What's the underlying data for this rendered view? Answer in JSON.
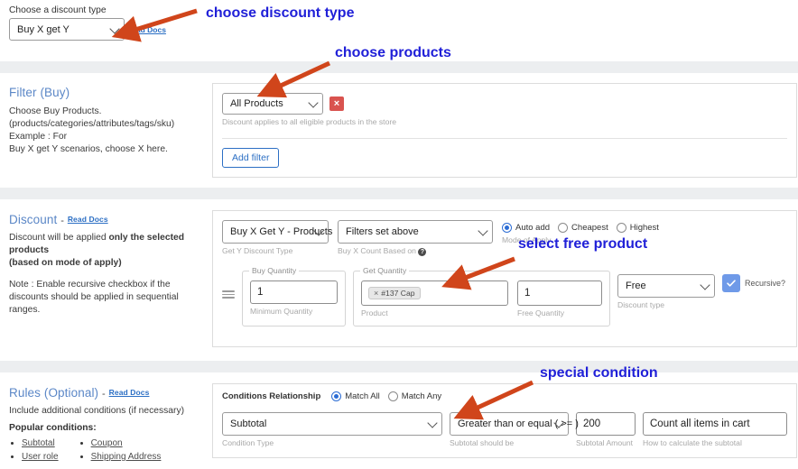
{
  "top": {
    "label": "Choose a discount type",
    "discount_type_value": "Buy X get Y",
    "read_docs": "Read Docs"
  },
  "filter_section": {
    "title": "Filter (Buy)",
    "description_line1": "Choose Buy Products.",
    "description_line2": "(products/categories/attributes/tags/sku) Example : For",
    "description_line3": "Buy X get Y scenarios, choose X here.",
    "product_select_value": "All Products",
    "remove_label": "×",
    "helper": "Discount applies to all eligible products in the store",
    "add_filter_label": "Add filter"
  },
  "discount_section": {
    "title": "Discount",
    "dash": "-",
    "read_docs": "Read Docs",
    "desc_a": "Discount will be applied ",
    "desc_a_bold": "only the selected products",
    "desc_b_bold": "(based on mode of apply)",
    "note": "Note : Enable recursive checkbox if the discounts should be applied in sequential ranges.",
    "get_y_type_value": "Buy X Get Y - Products",
    "get_y_type_helper": "Get Y Discount Type",
    "buy_x_count_value": "Filters set above",
    "buy_x_count_helper": "Buy X Count Based on",
    "mode_of_apply_label": "Mode of Apply",
    "mode_options": [
      {
        "label": "Auto add",
        "selected": true
      },
      {
        "label": "Cheapest",
        "selected": false
      },
      {
        "label": "Highest",
        "selected": false
      }
    ],
    "buy_quantity_legend": "Buy Quantity",
    "buy_quantity_value": "1",
    "buy_quantity_helper": "Minimum Quantity",
    "get_quantity_legend": "Get Quantity",
    "product_chip": "#137 Cap",
    "chip_remove": "×",
    "product_helper": "Product",
    "free_quantity_value": "1",
    "free_quantity_helper": "Free Quantity",
    "discount_type_value": "Free",
    "discount_type_helper": "Discount type",
    "recursive_label": "Recursive?"
  },
  "rules_section": {
    "title": "Rules (Optional)",
    "dash": "-",
    "read_docs": "Read Docs",
    "description": "Include additional conditions (if necessary)",
    "popular_label": "Popular conditions:",
    "popular_left": [
      "Subtotal",
      "User role"
    ],
    "popular_right": [
      "Coupon",
      "Shipping Address"
    ],
    "conditions_relationship_label": "Conditions Relationship",
    "relationship_options": [
      {
        "label": "Match All",
        "selected": true
      },
      {
        "label": "Match Any",
        "selected": false
      }
    ],
    "condition_type_value": "Subtotal",
    "condition_type_helper": "Condition Type",
    "operator_value": "Greater than or equal ( >= )",
    "operator_helper": "Subtotal should be",
    "amount_value": "200",
    "amount_helper": "Subtotal Amount",
    "calc_value": "Count all items in cart",
    "calc_helper": "How to calculate the subtotal"
  },
  "annotations": [
    {
      "text": "choose discount type"
    },
    {
      "text": "choose products"
    },
    {
      "text": "select free product"
    },
    {
      "text": "special condition"
    }
  ],
  "colors": {
    "annotation_text": "#2020d8",
    "annotation_arrow": "#d0451b",
    "section_title": "#5b87c7",
    "link": "#2c6fc4",
    "band": "#eceef0"
  }
}
